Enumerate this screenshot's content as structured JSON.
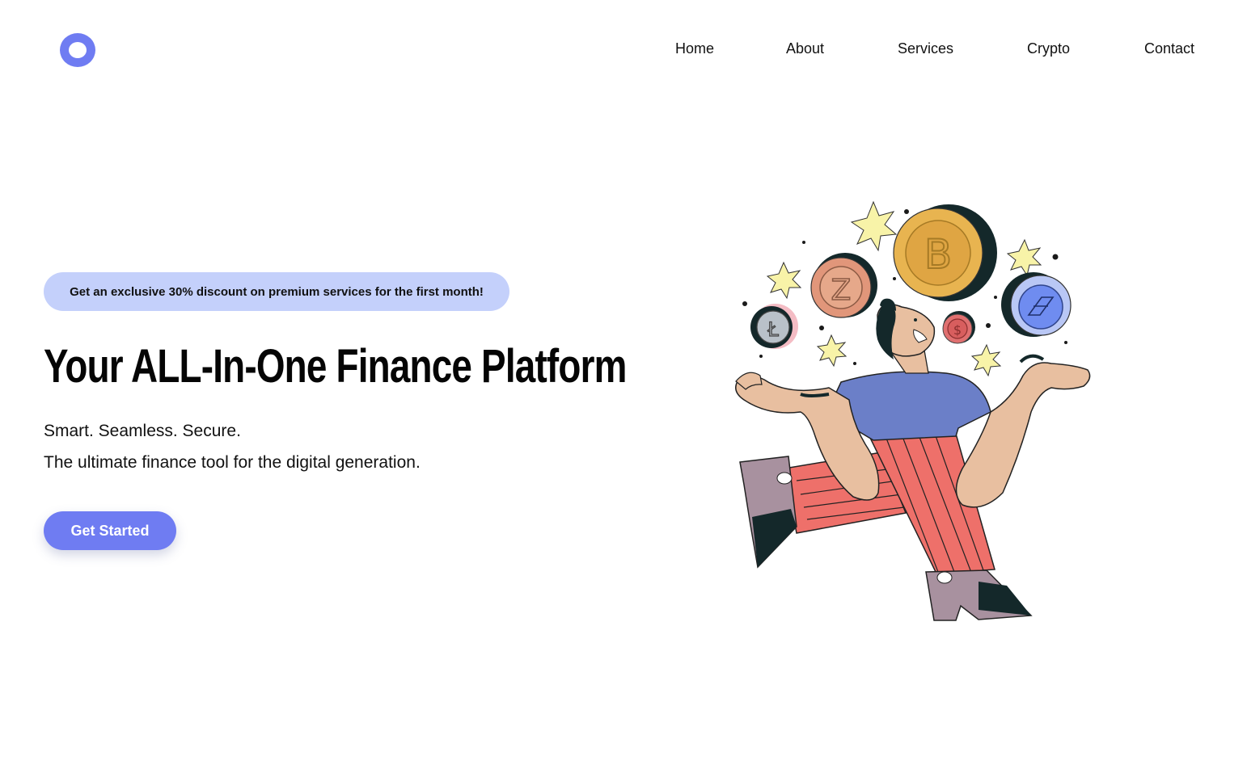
{
  "header": {
    "logo_icon": "ring-logo-icon",
    "nav": [
      {
        "label": "Home"
      },
      {
        "label": "About"
      },
      {
        "label": "Services"
      },
      {
        "label": "Crypto"
      },
      {
        "label": "Contact"
      }
    ]
  },
  "hero": {
    "promo": "Get an exclusive 30% discount on premium services for the first month!",
    "title": "Your ALL-In-One Finance Platform",
    "tagline": "Smart. Seamless. Secure.",
    "subline": "The ultimate finance tool for the digital generation.",
    "cta_label": "Get Started"
  },
  "illustration": {
    "icon": "crypto-juggler-illustration",
    "coins": [
      "bitcoin-coin-icon",
      "zcash-coin-icon",
      "litecoin-coin-icon",
      "dollar-coin-icon",
      "ethereum-coin-icon"
    ],
    "currency_symbol": "$"
  },
  "colors": {
    "accent": "#6f7cf2",
    "promo_bg": "#c4d0fb",
    "text": "#111111",
    "shirt": "#6b7fc8",
    "pants": "#ee706a",
    "skin": "#e8bfa0",
    "boots": "#a8919f",
    "gold": "#e8b450"
  }
}
